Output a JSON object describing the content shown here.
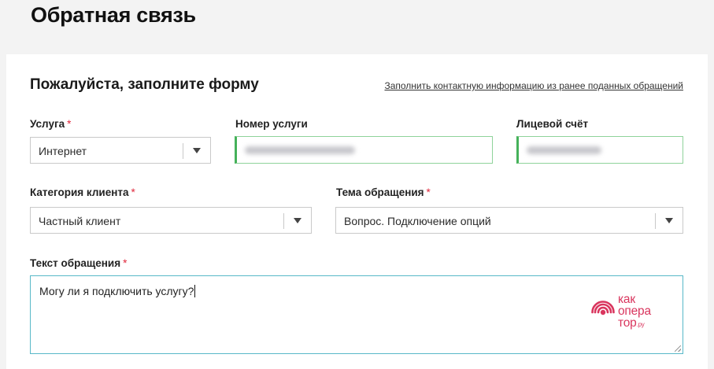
{
  "page": {
    "title": "Обратная связь"
  },
  "form": {
    "title": "Пожалуйста, заполните форму",
    "fill_link": "Заполнить контактную информацию из ранее поданных обращений",
    "required_mark": "*",
    "service": {
      "label": "Услуга",
      "value": "Интернет"
    },
    "service_number": {
      "label": "Номер услуги",
      "value_state": "blurred"
    },
    "account": {
      "label": "Лицевой счёт",
      "value_state": "blurred"
    },
    "client_category": {
      "label": "Категория клиента",
      "value": "Частный клиент"
    },
    "topic": {
      "label": "Тема обращения",
      "value": "Вопрос. Подключение опций"
    },
    "message": {
      "label": "Текст обращения",
      "value": "Могу ли я подключить услугу?"
    }
  },
  "watermark": {
    "lines": [
      "как",
      "опера",
      "тор"
    ],
    "suffix": ".ру",
    "color": "#d9365e"
  },
  "colors": {
    "valid_border": "#45b15a",
    "focus_border": "#58b8c8",
    "required": "#e0283c"
  }
}
